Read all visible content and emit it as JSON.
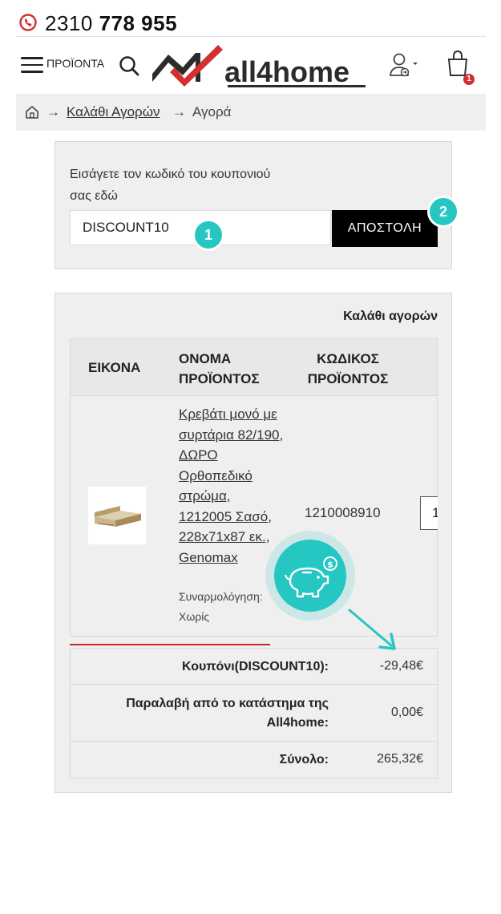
{
  "phone": {
    "prefix": "2310",
    "number": "778 955"
  },
  "header": {
    "menu_label": "ΠΡΟΪΟΝΤΑ",
    "logo_text": "all4home",
    "cart_count": "1"
  },
  "breadcrumb": {
    "sep": "→",
    "cart_link": "Καλάθι Αγορών",
    "current": "Αγορά"
  },
  "coupon": {
    "label": "Εισάγετε τον κωδικό του κουπονιού σας εδώ",
    "value": "DISCOUNT10",
    "button": "ΑΠΟΣΤΟΛΗ",
    "step1": "1",
    "step2": "2"
  },
  "cart": {
    "title": "Καλάθι αγορών",
    "headers": {
      "image": "ΕΙΚΟΝΑ",
      "name": "ΟΝΟΜΑ ΠΡΟΪΟΝΤΟΣ",
      "code": "ΚΩΔΙΚΟΣ ΠΡΟΪΟΝΤΟΣ"
    },
    "item": {
      "name": "Κρεβάτι μονό με συρτάρια 82/190, ΔΩΡΟ Ορθοπεδικό στρώμα, 1212005 Σασό, 228x71x87 εκ., Genomax",
      "attr_label": "Συναρμολόγηση:",
      "attr_value": "Χωρίς",
      "code": "1210008910",
      "qty": "1"
    },
    "totals": [
      {
        "label": "Κουπόνι(DISCOUNT10):",
        "value": "-29,48€"
      },
      {
        "label": "Παραλαβή από το κατάστημα της All4home:",
        "value": "0,00€"
      },
      {
        "label": "Σύνολο:",
        "value": "265,32€"
      }
    ]
  },
  "colors": {
    "accent": "#26c7c2",
    "brand_red": "#d32f2f",
    "button": "#000000"
  },
  "icons": [
    "phone-icon",
    "menu-icon",
    "search-icon",
    "user-icon",
    "cart-icon",
    "home-icon",
    "piggy-bank-icon",
    "arrow-icon"
  ]
}
